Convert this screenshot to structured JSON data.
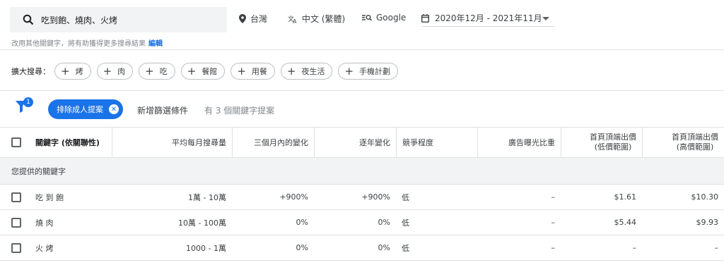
{
  "search": {
    "query": "吃到飽、燒肉、火烤",
    "location": "台灣",
    "language": "中文 (繁體)",
    "network": "Google",
    "date_range": "2020年12月 - 2021年11月",
    "hint": "改用其他關鍵字，將有助獲得更多搜尋結果",
    "edit_link": "編輯"
  },
  "broaden": {
    "label": "擴大搜尋：",
    "chips": [
      "烤",
      "肉",
      "吃",
      "餐館",
      "用餐",
      "夜生活",
      "手機計劃"
    ]
  },
  "filters": {
    "badge_count": "1",
    "active_filter": "排除成人提案",
    "add_filter": "新增篩選條件",
    "result_count": "有 3 個關鍵字提案"
  },
  "table": {
    "columns": [
      "關鍵字 (依關聯性)",
      "平均每月搜尋量",
      "三個月內的變化",
      "逐年變化",
      "競爭程度",
      "廣告曝光比重",
      "首頁頂端出價",
      "(低價範圍)",
      "首頁頂端出價",
      "(高價範圍)"
    ],
    "group_label": "您提供的關鍵字",
    "rows": [
      {
        "keyword": "吃 到 飽",
        "volume": "1萬 - 10萬",
        "three_month": "+900%",
        "yoy": "+900%",
        "competition": "低",
        "impression_share": "–",
        "bid_low": "$1.61",
        "bid_high": "$10.30"
      },
      {
        "keyword": "燒 肉",
        "volume": "10萬 - 100萬",
        "three_month": "0%",
        "yoy": "0%",
        "competition": "低",
        "impression_share": "–",
        "bid_low": "$5.44",
        "bid_high": "$9.93"
      },
      {
        "keyword": "火 烤",
        "volume": "1000 - 1萬",
        "three_month": "0%",
        "yoy": "0%",
        "competition": "低",
        "impression_share": "–",
        "bid_low": "–",
        "bid_high": "–"
      }
    ]
  }
}
